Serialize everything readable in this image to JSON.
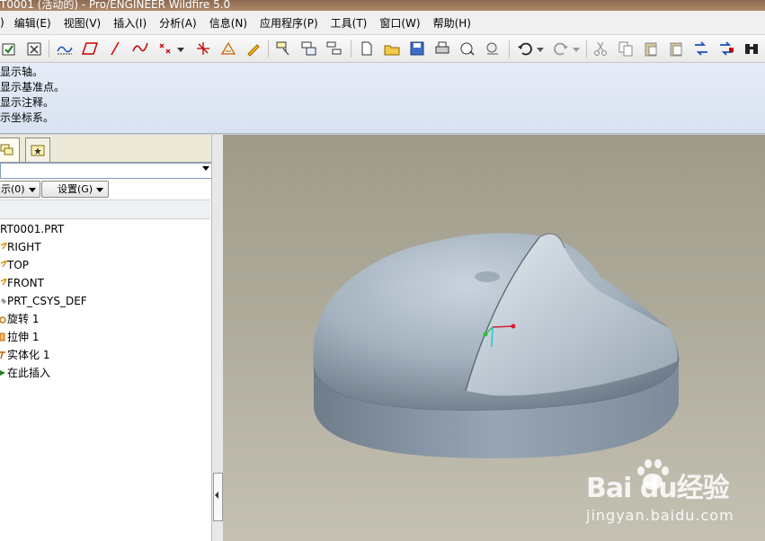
{
  "window": {
    "title": "T0001 (活动的) - Pro/ENGINEER Wildfire 5.0"
  },
  "menubar": {
    "items": [
      {
        "label": ")"
      },
      {
        "label": "编辑(E)"
      },
      {
        "label": "视图(V)"
      },
      {
        "label": "插入(I)"
      },
      {
        "label": "分析(A)"
      },
      {
        "label": "信息(N)"
      },
      {
        "label": "应用程序(P)"
      },
      {
        "label": "工具(T)"
      },
      {
        "label": "窗口(W)"
      },
      {
        "label": "帮助(H)"
      }
    ]
  },
  "toolbar": {
    "icons": [
      "regenerate-check-icon",
      "close-window-icon",
      "datum-plane-icon",
      "datum-plane-display-icon",
      "datum-axis-icon",
      "sketch-curve-icon",
      "datum-point-icon",
      "csys-icon",
      "analysis-icon",
      "annotation-icon",
      "select-filter-icon",
      "find-icon",
      "model-tree-icon",
      "new-file-icon",
      "open-file-icon",
      "save-icon",
      "print-icon",
      "send-email-icon",
      "email-attach-icon",
      "undo-icon",
      "redo-icon",
      "cut-icon",
      "copy-icon",
      "paste-icon",
      "paste-special-icon",
      "regenerate-icon",
      "regenerate-manager-icon",
      "find-binoculars-icon"
    ]
  },
  "messages": {
    "lines": [
      "显示轴。",
      "显示基准点。",
      "显示注释。",
      "示坐标系。"
    ]
  },
  "left_panel": {
    "tabs": [
      {
        "name": "model-tree-tab",
        "icon": "layers-icon"
      },
      {
        "name": "favorites-tab",
        "icon": "star-folder-icon"
      }
    ],
    "dropdown_value": "",
    "show_button": "示(0)",
    "settings_button": "设置(G)",
    "tree": {
      "root": "RT0001.PRT",
      "items": [
        {
          "label": "RIGHT",
          "icon": "datum-plane-icon",
          "color": "#d49000"
        },
        {
          "label": "TOP",
          "icon": "datum-plane-icon",
          "color": "#d49000"
        },
        {
          "label": "FRONT",
          "icon": "datum-plane-icon",
          "color": "#d49000"
        },
        {
          "label": "PRT_CSYS_DEF",
          "icon": "csys-icon",
          "color": "#888888"
        },
        {
          "label": "旋转 1",
          "icon": "revolve-icon",
          "color": "#c06000"
        },
        {
          "label": "拉伸 1",
          "icon": "extrude-icon",
          "color": "#c06000"
        },
        {
          "label": "实体化 1",
          "icon": "solidify-icon",
          "color": "#c06000"
        },
        {
          "label": "在此插入",
          "icon": "insert-here-arrow-icon",
          "color": "#208020"
        }
      ]
    }
  },
  "viewport": {
    "model": "part-3d-model",
    "watermark": {
      "logo": "Bai du经验",
      "url": "jingyan.baidu.com"
    }
  },
  "colors": {
    "model_face": "#8fa0b2",
    "viewport_bg_top": "#9f9b8b",
    "viewport_bg_bottom": "#c4c1b3",
    "message_bg": "#e0e7f4"
  }
}
